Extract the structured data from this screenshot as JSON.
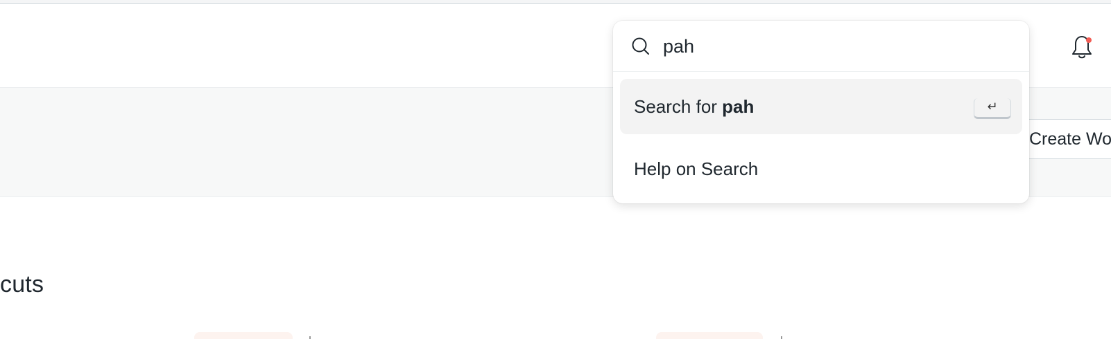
{
  "search": {
    "query": "pah",
    "results": {
      "search_prefix": "Search for ",
      "search_term": "pah",
      "enter_key": "↵",
      "help": "Help on Search"
    }
  },
  "page_head": {
    "create_button": "Create Wo"
  },
  "main": {
    "section_title": "cuts"
  },
  "colors": {
    "notification_dot": "#f25c54",
    "active_result_bg": "#f3f3f3",
    "page_head_bg": "#f7f8f8"
  }
}
